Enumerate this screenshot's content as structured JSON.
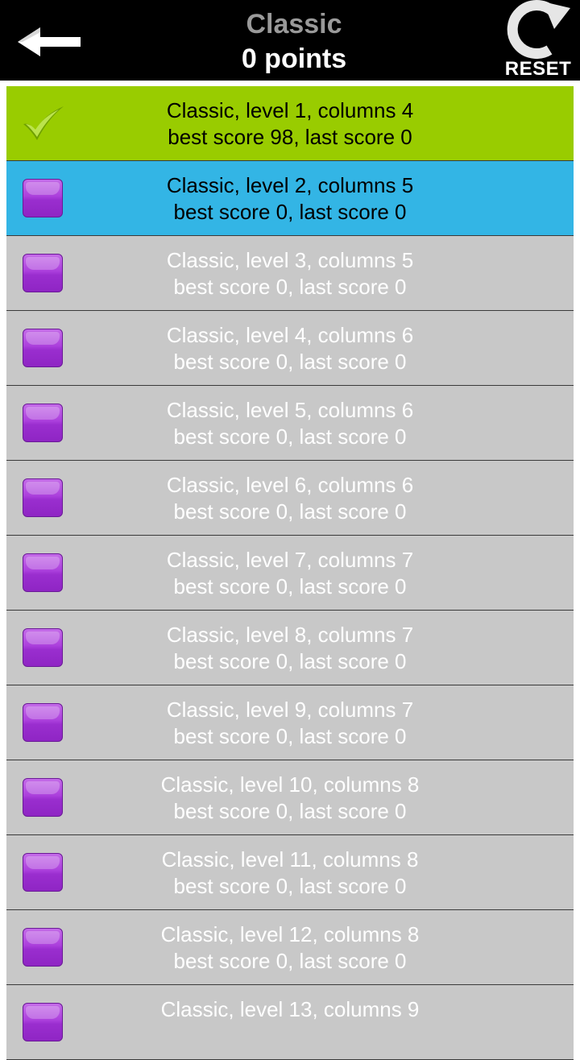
{
  "header": {
    "title": "Classic",
    "points": "0 points",
    "reset_label": "RESET",
    "back_icon": "left-arrow-icon",
    "reset_icon": "rotate-arrow-icon"
  },
  "colors": {
    "topbar": "#000000",
    "completed_row": "#99cc00",
    "current_row": "#33b5e5",
    "locked_row": "#c8c8c8",
    "level_box": "#9a2ecf"
  },
  "levels": [
    {
      "line1": "Classic, level 1, columns 4",
      "line2": "best score 98, last score 0",
      "state": "completed",
      "icon": "checkmark-icon"
    },
    {
      "line1": "Classic, level 2, columns 5",
      "line2": "best score 0, last score 0",
      "state": "current",
      "icon": "purple-box-icon"
    },
    {
      "line1": "Classic, level 3, columns 5",
      "line2": "best score 0, last score 0",
      "state": "locked",
      "icon": "purple-box-icon"
    },
    {
      "line1": "Classic, level 4, columns 6",
      "line2": "best score 0, last score 0",
      "state": "locked",
      "icon": "purple-box-icon"
    },
    {
      "line1": "Classic, level 5, columns 6",
      "line2": "best score 0, last score 0",
      "state": "locked",
      "icon": "purple-box-icon"
    },
    {
      "line1": "Classic, level 6, columns 6",
      "line2": "best score 0, last score 0",
      "state": "locked",
      "icon": "purple-box-icon"
    },
    {
      "line1": "Classic, level 7, columns 7",
      "line2": "best score 0, last score 0",
      "state": "locked",
      "icon": "purple-box-icon"
    },
    {
      "line1": "Classic, level 8, columns 7",
      "line2": "best score 0, last score 0",
      "state": "locked",
      "icon": "purple-box-icon"
    },
    {
      "line1": "Classic, level 9, columns 7",
      "line2": "best score 0, last score 0",
      "state": "locked",
      "icon": "purple-box-icon"
    },
    {
      "line1": "Classic, level 10, columns 8",
      "line2": "best score 0, last score 0",
      "state": "locked",
      "icon": "purple-box-icon"
    },
    {
      "line1": "Classic, level 11, columns 8",
      "line2": "best score 0, last score 0",
      "state": "locked",
      "icon": "purple-box-icon"
    },
    {
      "line1": "Classic, level 12, columns 8",
      "line2": "best score 0, last score 0",
      "state": "locked",
      "icon": "purple-box-icon"
    },
    {
      "line1": "Classic, level 13, columns 9",
      "line2": "",
      "state": "locked",
      "icon": "purple-box-icon"
    }
  ]
}
